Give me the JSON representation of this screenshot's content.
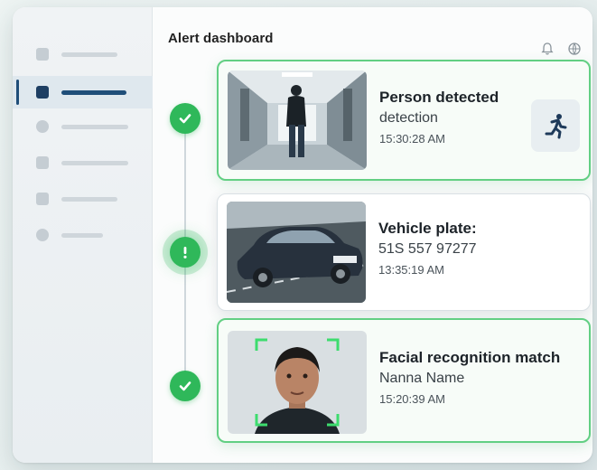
{
  "header": {
    "title": "Alert dashboard",
    "icons": [
      "bell-icon",
      "globe-icon"
    ]
  },
  "sidebar": {
    "items": [
      {
        "icon": "home-icon",
        "active": false
      },
      {
        "icon": "alert-icon",
        "active": true
      },
      {
        "icon": "clock-icon",
        "active": false
      },
      {
        "icon": "chart-icon",
        "active": false
      },
      {
        "icon": "list-icon",
        "active": false
      },
      {
        "icon": "settings-icon",
        "active": false
      }
    ]
  },
  "alerts": [
    {
      "title": "Person detected",
      "subtitle": "detection",
      "time": "15:30:28 AM",
      "status": "ok",
      "action_icon": "running-person-icon"
    },
    {
      "title": "Vehicle plate:",
      "subtitle": "51S 557 97277",
      "time": "13:35:19 AM",
      "status": "warning"
    },
    {
      "title": "Facial recognition match",
      "subtitle": "Nanna Name",
      "time": "15:20:39 AM",
      "status": "ok"
    }
  ],
  "colors": {
    "accent": "#2fb85a",
    "nav_active": "#1f4e79"
  }
}
